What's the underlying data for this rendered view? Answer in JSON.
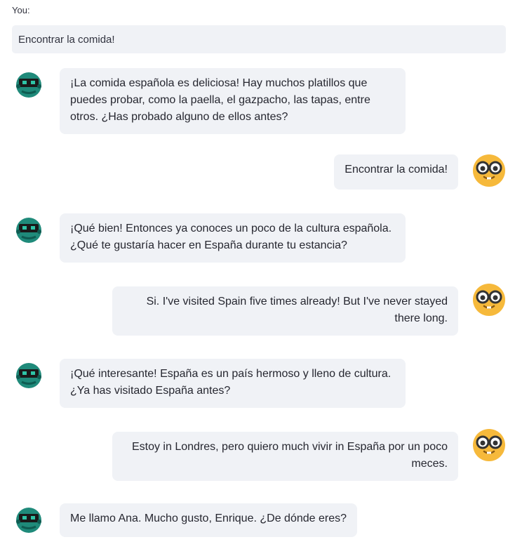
{
  "input": {
    "label": "You:",
    "value": "Encontrar la comida!"
  },
  "messages": [
    {
      "role": "bot",
      "text": "¡La comida española es deliciosa! Hay muchos platillos que puedes probar, como la paella, el gazpacho, las tapas, entre otros. ¿Has probado alguno de ellos antes?"
    },
    {
      "role": "user",
      "text": "Encontrar la comida!"
    },
    {
      "role": "bot",
      "text": "¡Qué bien! Entonces ya conoces un poco de la cultura española. ¿Qué te gustaría hacer en España durante tu estancia?"
    },
    {
      "role": "user",
      "text": "Si. I've visited Spain five times already! But I've never stayed there long."
    },
    {
      "role": "bot",
      "text": "¡Qué interesante! España es un país hermoso y lleno de cultura. ¿Ya has visitado España antes?"
    },
    {
      "role": "user",
      "text": "Estoy in Londres, pero quiero much vivir in España por un poco meces."
    },
    {
      "role": "bot",
      "text": "Me llamo Ana. Mucho gusto, Enrique. ¿De dónde eres?"
    }
  ],
  "avatars": {
    "bot": "bot-avatar",
    "user": "nerd-face-avatar"
  },
  "colors": {
    "bubble": "#f0f2f6",
    "bot_avatar": "#1f8a7a",
    "user_avatar": "#f6b93b"
  }
}
